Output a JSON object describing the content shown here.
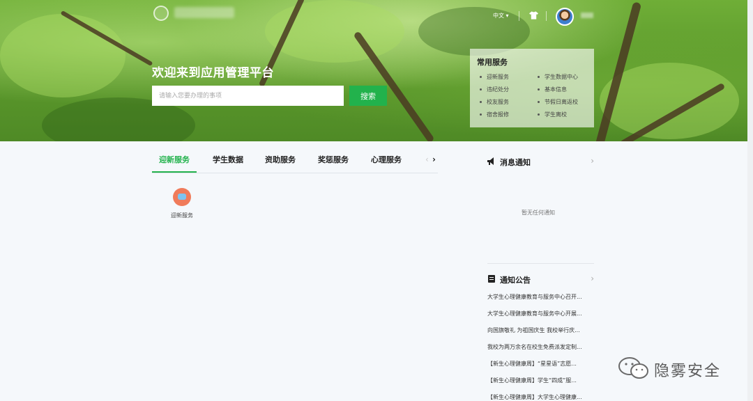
{
  "header": {
    "language": "中文 ▾",
    "welcome": "欢迎来到应用管理平台",
    "search": {
      "placeholder": "请输入您要办理的事项",
      "button": "搜索"
    },
    "icons": [
      "logo-seal",
      "shirt-icon",
      "user-avatar"
    ]
  },
  "common_services": {
    "title": "常用服务",
    "items": [
      "迎新服务",
      "学生数据中心",
      "违纪处分",
      "基本信息",
      "校友服务",
      "节假日离返校",
      "宿舍报修",
      "学生离校"
    ]
  },
  "tabs": {
    "items": [
      "迎新服务",
      "学生数据",
      "资助服务",
      "奖惩服务",
      "心理服务"
    ],
    "active": 0
  },
  "tiles": [
    {
      "label": "迎新服务",
      "icon": "welcome-flag-icon"
    }
  ],
  "notices": {
    "title": "消息通知",
    "empty": "暂无任何通知"
  },
  "announcements": {
    "title": "通知公告",
    "items": [
      "大学生心理健康教育与服务中心召开...",
      "大学生心理健康教育与服务中心开展...",
      "向国旗敬礼 为祖国庆生 我校举行庆...",
      "我校为两万余名在校生免费派发定制...",
      "【新生心理健康周】“星星语”志愿...",
      "【新生心理健康周】学生“四成”服...",
      "【新生心理健康周】大学生心理健康..."
    ]
  },
  "watermark": "隐雾安全",
  "colors": {
    "accent": "#22b24c",
    "page_bg": "#f5f8fb"
  }
}
